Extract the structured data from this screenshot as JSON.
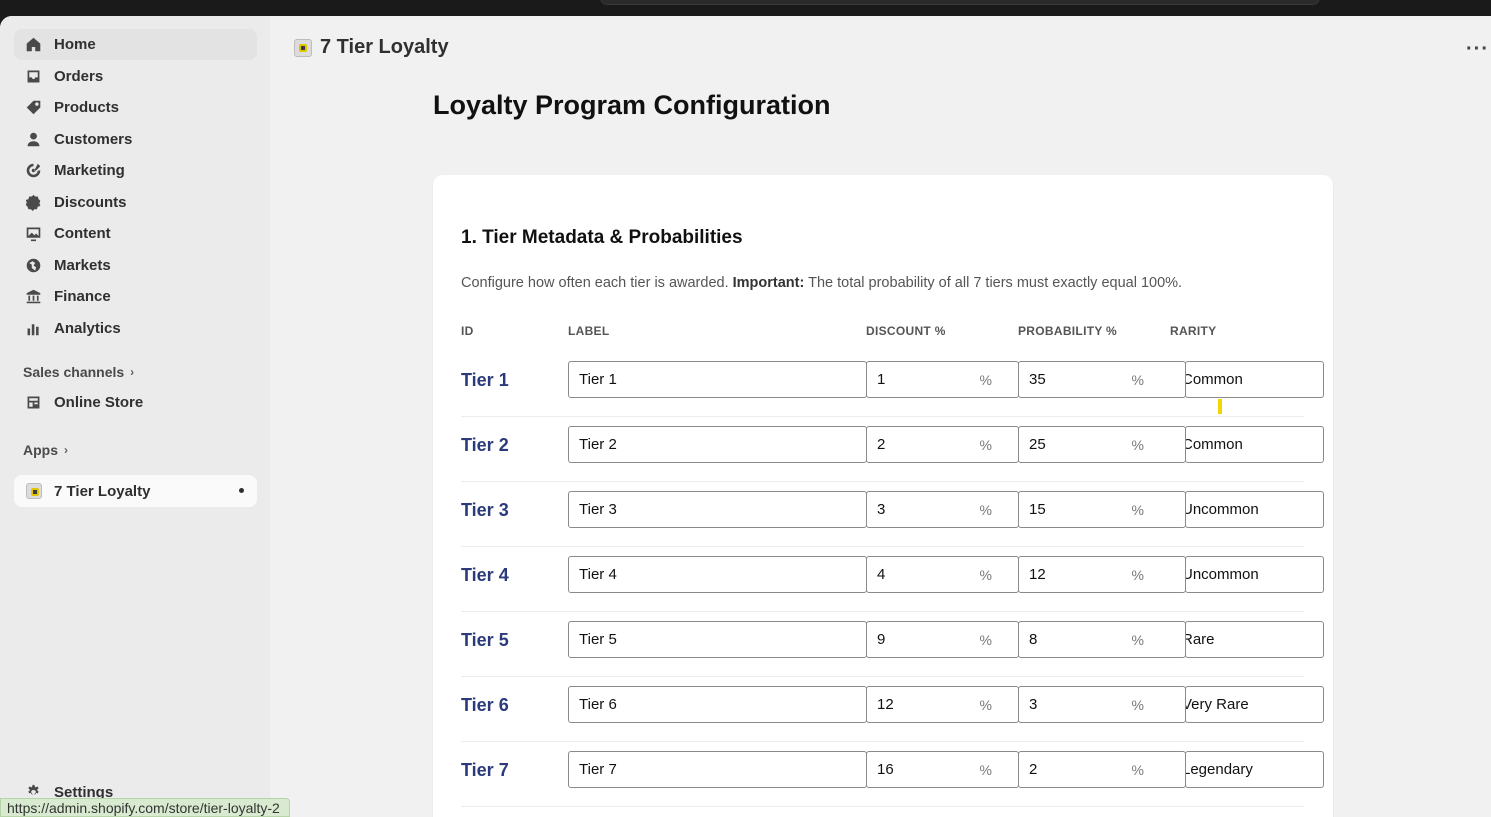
{
  "sidebar": {
    "items": [
      {
        "label": "Home",
        "icon": "home-icon"
      },
      {
        "label": "Orders",
        "icon": "inbox-icon"
      },
      {
        "label": "Products",
        "icon": "tag-icon"
      },
      {
        "label": "Customers",
        "icon": "person-icon"
      },
      {
        "label": "Marketing",
        "icon": "target-icon"
      },
      {
        "label": "Discounts",
        "icon": "discount-icon"
      },
      {
        "label": "Content",
        "icon": "image-icon"
      },
      {
        "label": "Markets",
        "icon": "globe-icon"
      },
      {
        "label": "Finance",
        "icon": "bank-icon"
      },
      {
        "label": "Analytics",
        "icon": "bar-chart-icon"
      }
    ],
    "sales_channels_label": "Sales channels",
    "online_store_label": "Online Store",
    "apps_label": "Apps",
    "active_app_label": "7 Tier Loyalty",
    "settings_label": "Settings"
  },
  "header": {
    "app_title": "7 Tier Loyalty",
    "more_label": "···"
  },
  "page": {
    "title": "Loyalty Program Configuration"
  },
  "card": {
    "title": "1. Tier Metadata & Probabilities",
    "desc_prefix": "Configure how often each tier is awarded. ",
    "desc_bold": "Important:",
    "desc_suffix": " The total probability of all 7 tiers must exactly equal 100%.",
    "columns": {
      "id": "ID",
      "label": "LABEL",
      "discount": "DISCOUNT %",
      "probability": "PROBABILITY %",
      "rarity": "RARITY"
    },
    "percent_symbol": "%",
    "rows": [
      {
        "id": "Tier 1",
        "label": "Tier 1",
        "discount": "1",
        "probability": "35",
        "rarity": "Common"
      },
      {
        "id": "Tier 2",
        "label": "Tier 2",
        "discount": "2",
        "probability": "25",
        "rarity": "Common"
      },
      {
        "id": "Tier 3",
        "label": "Tier 3",
        "discount": "3",
        "probability": "15",
        "rarity": "Uncommon"
      },
      {
        "id": "Tier 4",
        "label": "Tier 4",
        "discount": "4",
        "probability": "12",
        "rarity": "Uncommon"
      },
      {
        "id": "Tier 5",
        "label": "Tier 5",
        "discount": "9",
        "probability": "8",
        "rarity": "Rare"
      },
      {
        "id": "Tier 6",
        "label": "Tier 6",
        "discount": "12",
        "probability": "3",
        "rarity": "Very Rare"
      },
      {
        "id": "Tier 7",
        "label": "Tier 7",
        "discount": "16",
        "probability": "2",
        "rarity": "Legendary"
      }
    ]
  },
  "status_bar": {
    "url": "https://admin.shopify.com/store/tier-loyalty-2"
  },
  "colors": {
    "tier_id": "#2b3a7a",
    "sidebar_bg": "#ebebeb",
    "main_bg": "#f1f1f1",
    "status_bg": "#d8ebd0"
  }
}
